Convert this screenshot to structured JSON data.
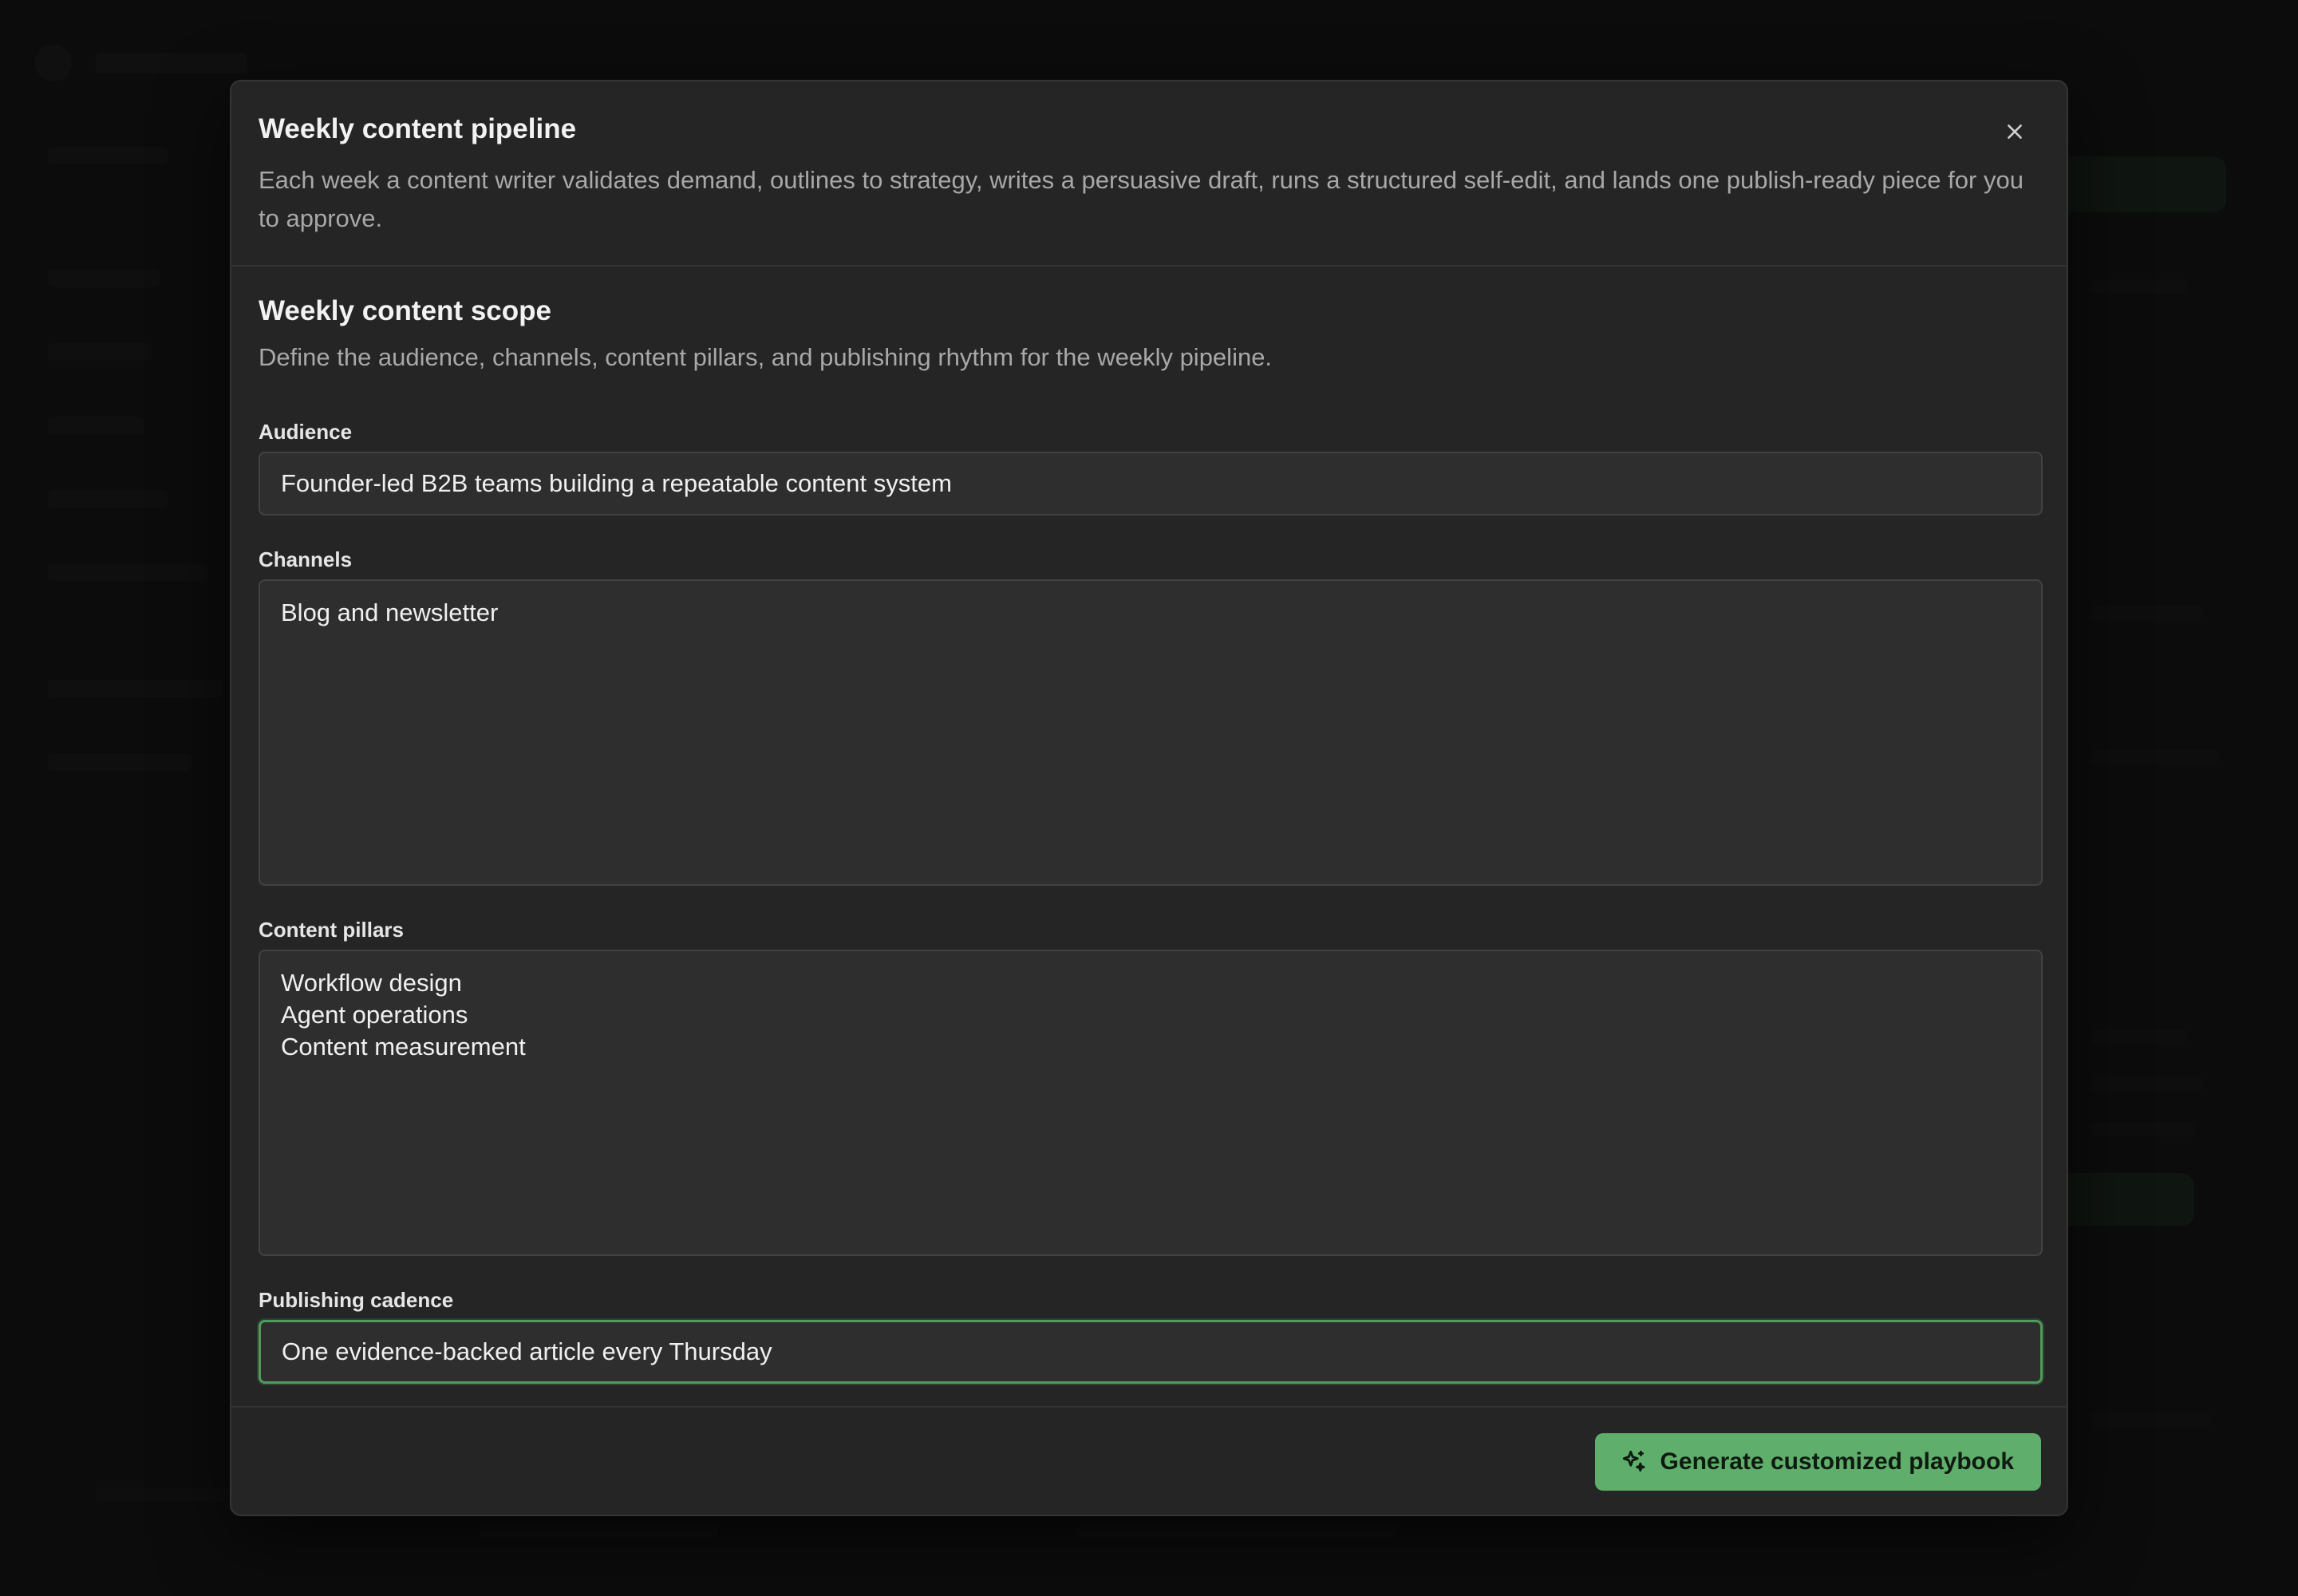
{
  "modal": {
    "title": "Weekly content pipeline",
    "description": "Each week a content writer validates demand, outlines to strategy, writes a persuasive draft, runs a structured self-edit, and lands one publish-ready piece for you to approve.",
    "close_icon": "close-icon"
  },
  "section": {
    "title": "Weekly content scope",
    "description": "Define the audience, channels, content pillars, and publishing rhythm for the weekly pipeline."
  },
  "fields": {
    "audience": {
      "label": "Audience",
      "value": "Founder-led B2B teams building a repeatable content system"
    },
    "channels": {
      "label": "Channels",
      "value": "Blog and newsletter"
    },
    "pillars": {
      "label": "Content pillars",
      "value": "Workflow design\nAgent operations\nContent measurement"
    },
    "cadence": {
      "label": "Publishing cadence",
      "value": "One evidence-backed article every Thursday"
    }
  },
  "footer": {
    "primary_label": "Generate customized playbook",
    "primary_icon": "sparkles-icon"
  },
  "colors": {
    "accent": "#5fae6c",
    "focus_border": "#4f9a5c",
    "modal_bg": "#252525"
  }
}
